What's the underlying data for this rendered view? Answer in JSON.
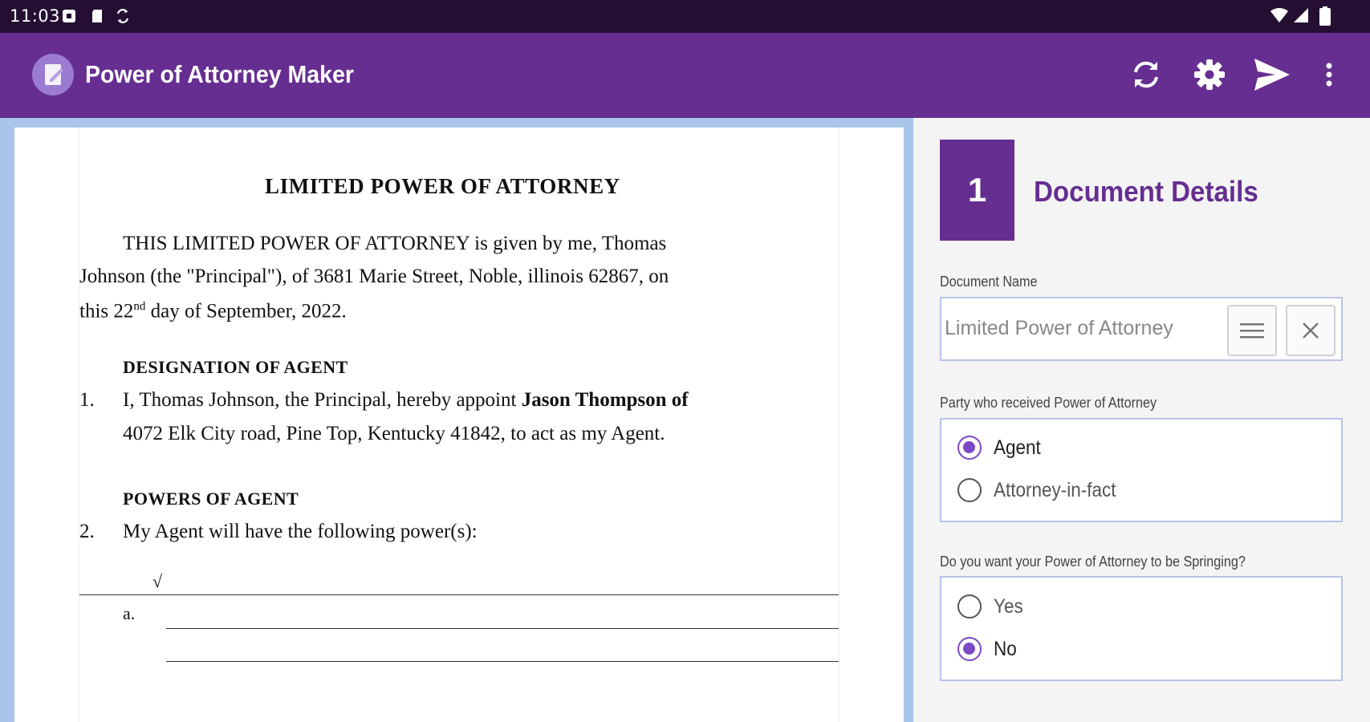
{
  "status_bar": {
    "time": "11:03",
    "left_icons": [
      "notification-icon",
      "sd-card-icon",
      "sync-icon"
    ],
    "right_icons": [
      "wifi-icon",
      "cell-signal-icon",
      "battery-icon"
    ]
  },
  "app_bar": {
    "title": "Power of Attorney Maker",
    "actions": [
      "refresh-icon",
      "settings-icon",
      "send-icon",
      "more-vert-icon"
    ],
    "color": "#662e91"
  },
  "document": {
    "title": "LIMITED POWER OF ATTORNEY",
    "intro_line1": "THIS LIMITED POWER OF ATTORNEY is given by me, Thomas",
    "intro_line2": "Johnson (the \"Principal\"), of 3681 Marie Street, Noble, illinois 62867, on",
    "intro_line3_pre": "this 22",
    "intro_line3_sup": "nd",
    "intro_line3_post": " day of September, 2022.",
    "section1_heading": "DESIGNATION OF AGENT",
    "item1_number": "1.",
    "item1_line1_pre": "I, Thomas Johnson, the Principal, hereby appoint ",
    "item1_line1_bold": "Jason Thompson of",
    "item1_line2": "4072 Elk City road, Pine Top, Kentucky 41842, to act as my Agent.",
    "section2_heading": "POWERS OF AGENT",
    "item2_number": "2.",
    "item2_text": "My Agent will have the following power(s):",
    "checkmark": "√",
    "sub_a": "a."
  },
  "form": {
    "step_number": "1",
    "section_title": "Document Details",
    "document_name_label": "Document Name",
    "document_name_value": "Limited Power of Attorney",
    "party_label": "Party who received Power of Attorney",
    "party_options": [
      {
        "label": "Agent",
        "selected": true
      },
      {
        "label": "Attorney-in-fact",
        "selected": false
      }
    ],
    "springing_label": "Do you want your Power of Attorney to be Springing?",
    "springing_options": [
      {
        "label": "Yes",
        "selected": false
      },
      {
        "label": "No",
        "selected": true
      }
    ],
    "accent_color": "#7b49c6"
  }
}
